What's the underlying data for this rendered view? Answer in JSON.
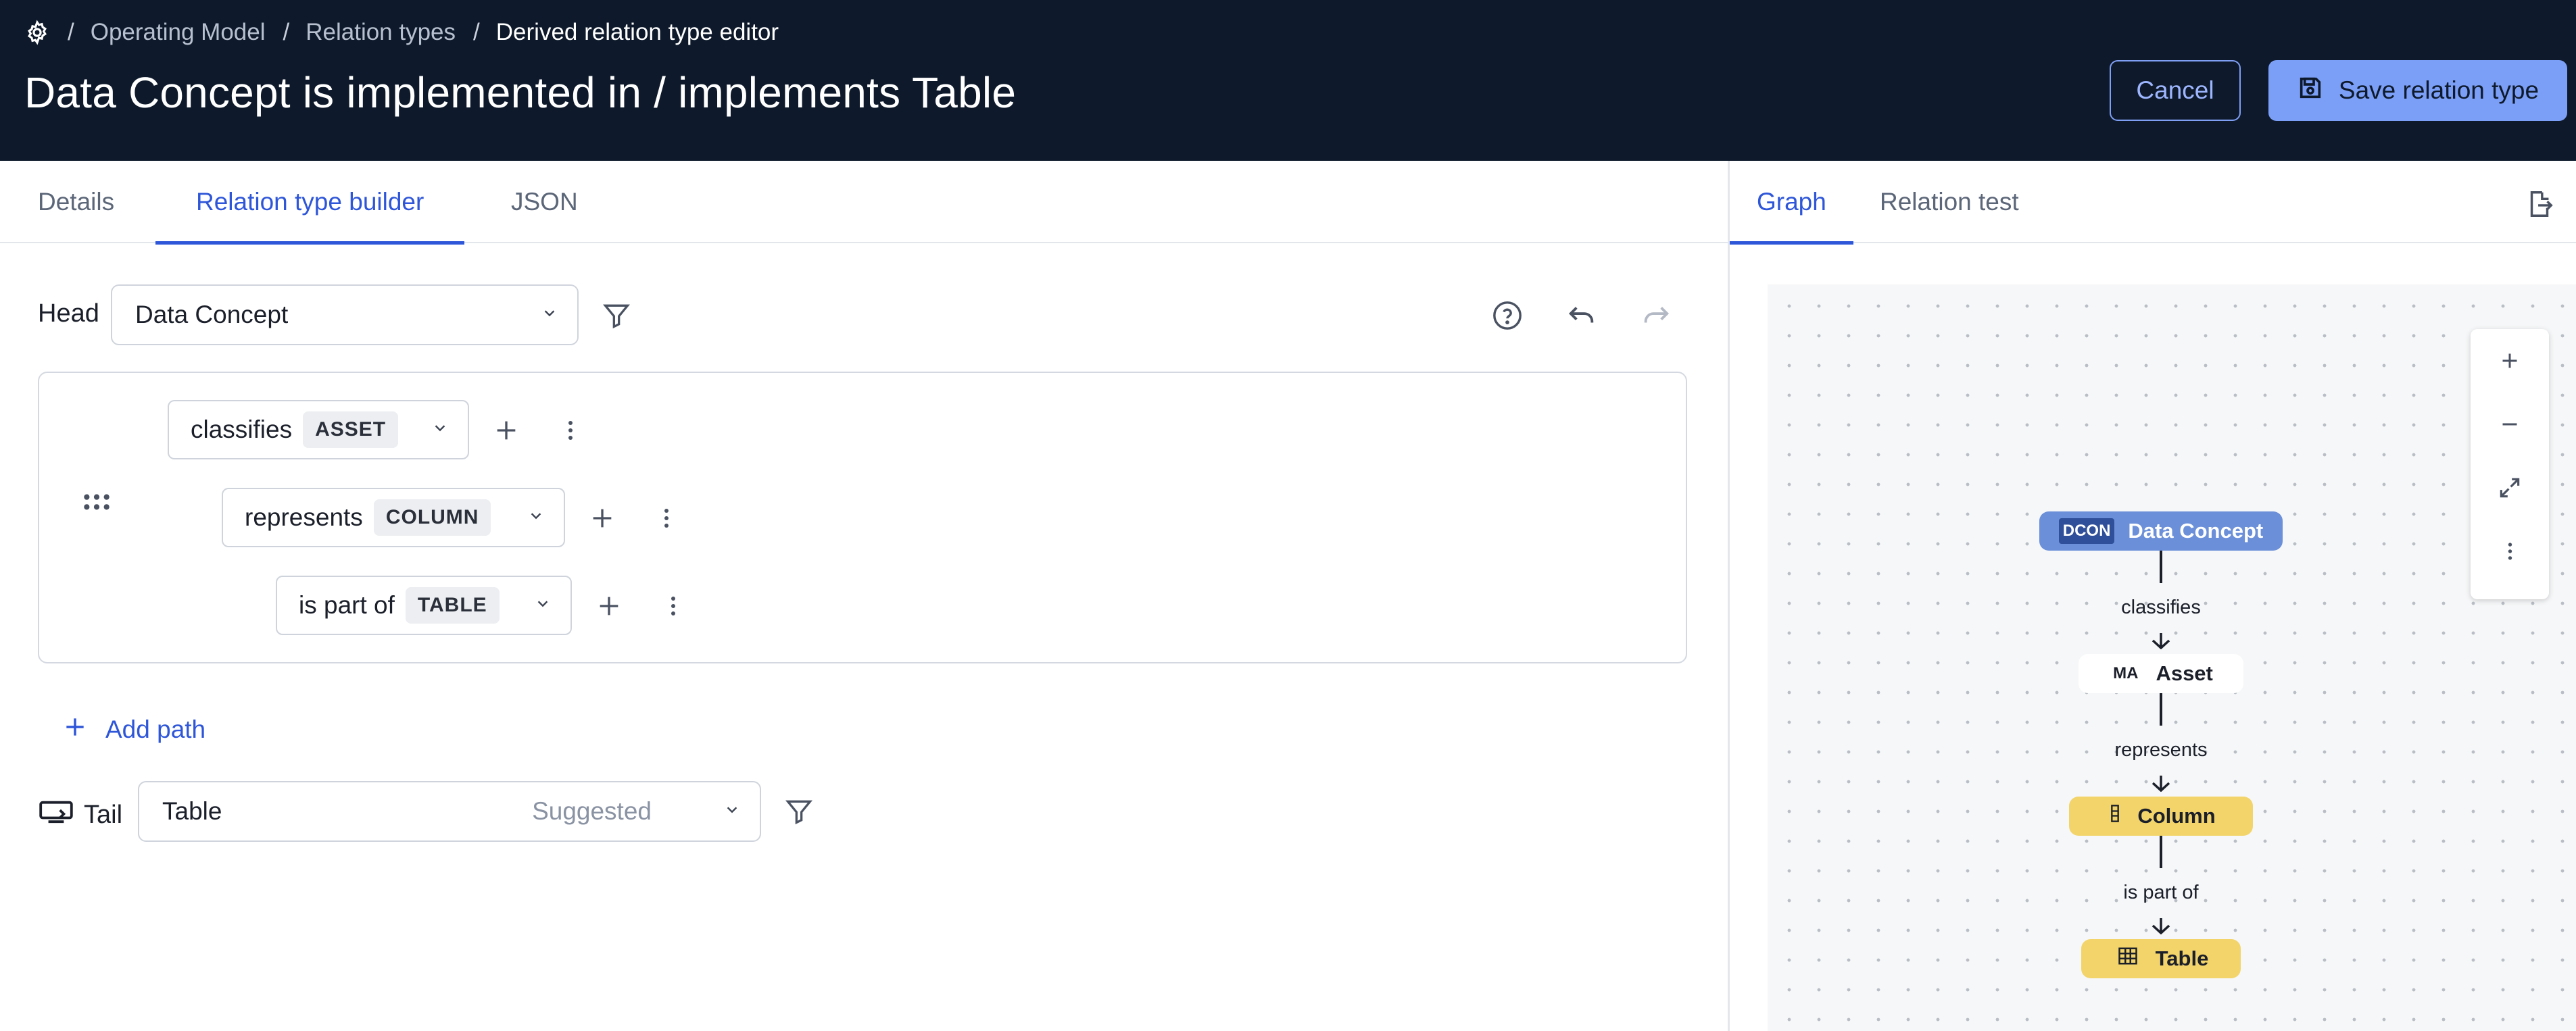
{
  "header": {
    "breadcrumbs": [
      "Operating Model",
      "Relation types",
      "Derived relation type editor"
    ],
    "title": "Data Concept is implemented in / implements Table",
    "cancel_label": "Cancel",
    "save_label": "Save relation type"
  },
  "left_tabs": [
    "Details",
    "Relation type builder",
    "JSON"
  ],
  "left_active_tab": "Relation type builder",
  "head": {
    "label": "Head",
    "value": "Data Concept"
  },
  "path": [
    {
      "relation": "classifies",
      "type": "ASSET"
    },
    {
      "relation": "represents",
      "type": "COLUMN"
    },
    {
      "relation": "is part of",
      "type": "TABLE"
    }
  ],
  "add_path_label": "Add path",
  "tail": {
    "label": "Tail",
    "value": "Table",
    "hint": "Suggested"
  },
  "right_tabs": [
    "Graph",
    "Relation test"
  ],
  "right_active_tab": "Graph",
  "graph": {
    "nodes": [
      {
        "tag": "DCON",
        "label": "Data Concept",
        "color": "#6b8fd8"
      },
      {
        "tag": "MA",
        "label": "Asset",
        "color": "#ffffff"
      },
      {
        "tag": "column-icon",
        "label": "Column",
        "color": "#f3d46a"
      },
      {
        "tag": "table-icon",
        "label": "Table",
        "color": "#f3d46a"
      }
    ],
    "edges": [
      "classifies",
      "represents",
      "is part of"
    ]
  },
  "colors": {
    "header_bg": "#0e1a2b",
    "accent": "#2e56d8",
    "save_button": "#7b9ef7"
  }
}
